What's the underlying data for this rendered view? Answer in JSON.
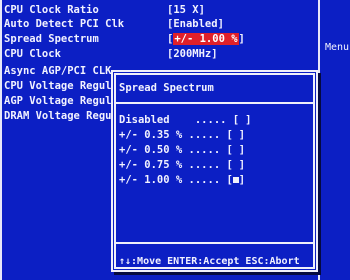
{
  "menu": {
    "rows": [
      {
        "label": "CPU Clock Ratio",
        "value": "[15 X]"
      },
      {
        "label": "Auto Detect PCI Clk",
        "value": "[Enabled]"
      },
      {
        "label": "Spread Spectrum",
        "value_open": "[",
        "value_hl": "+/- 1.00 %",
        "value_close": "]"
      },
      {
        "label": "CPU Clock",
        "value": "[200MHz]"
      },
      {
        "label": "Async AGP/PCI CLK",
        "value": ""
      },
      {
        "label": "CPU Voltage Regul",
        "value": ""
      },
      {
        "label": "AGP Voltage Regul",
        "value": ""
      },
      {
        "label": "DRAM Voltage Regu",
        "value": ""
      }
    ],
    "help_label": "Menu"
  },
  "popup": {
    "title": "Spread Spectrum",
    "options": [
      {
        "label": "Disabled    ..... [",
        "selected": false
      },
      {
        "label": "+/- 0.35 % ..... [",
        "selected": false
      },
      {
        "label": "+/- 0.50 % ..... [",
        "selected": false
      },
      {
        "label": "+/- 0.75 % ..... [",
        "selected": false
      },
      {
        "label": "+/- 1.00 % ..... [",
        "selected": true
      }
    ],
    "footer": "↑↓:Move ENTER:Accept ESC:Abort"
  },
  "colors": {
    "background": "#0c1fc4",
    "text": "#f2f2ff",
    "highlight": "#e0202a"
  }
}
